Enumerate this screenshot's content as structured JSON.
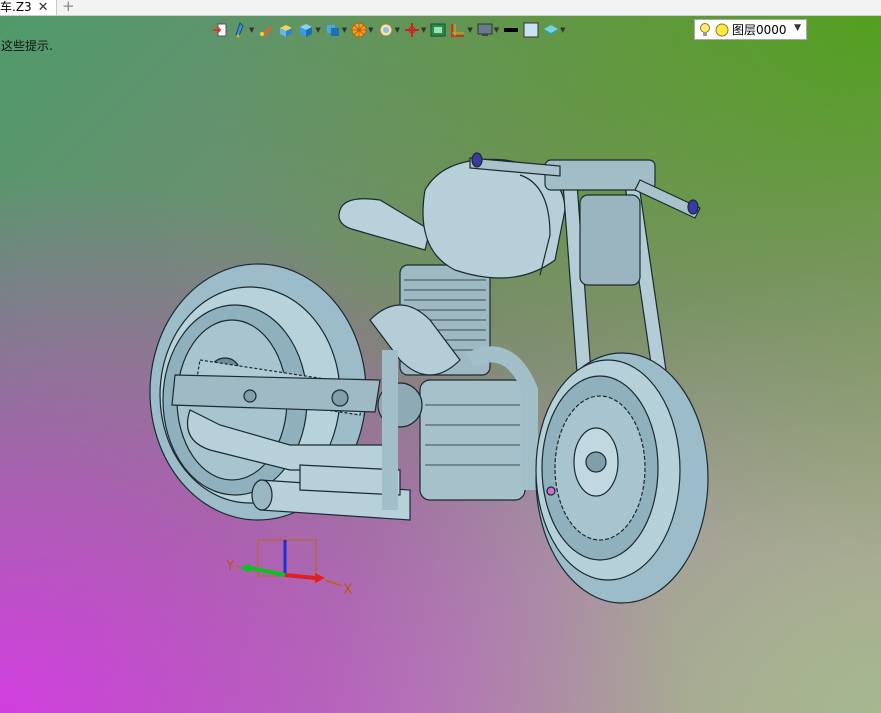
{
  "tab": {
    "title": "车.Z3",
    "close": "✕",
    "add": "+"
  },
  "hint": "这些提示.",
  "toolbar": {
    "icons": [
      "import-icon",
      "pen-icon",
      "brush-icon",
      "box-yellow-icon",
      "cube-icon",
      "shaded-cube-icon",
      "wheel-icon",
      "render-icon",
      "axis-icon",
      "screen-icon",
      "grid-icon",
      "display-icon",
      "black-line-icon",
      "light-square-icon",
      "layer-stack-icon"
    ],
    "layer_name": "图层0000"
  },
  "axes": {
    "x": "X",
    "y": "Y"
  }
}
